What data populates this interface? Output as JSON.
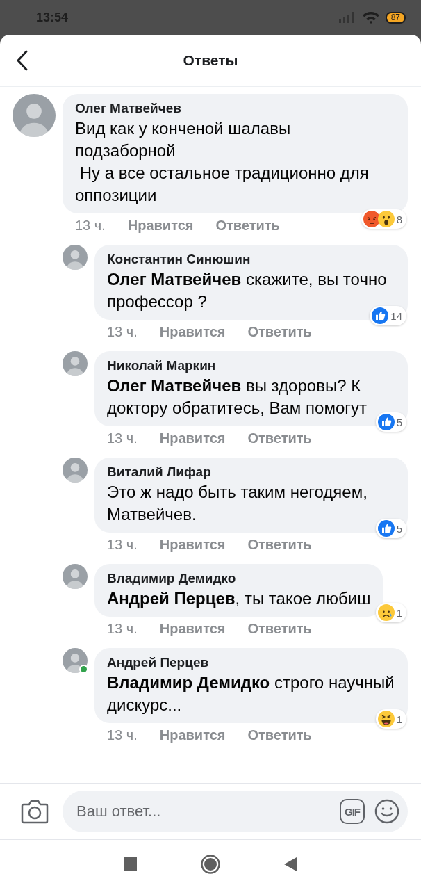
{
  "status_bar": {
    "time": "13:54",
    "battery": "87"
  },
  "header": {
    "title": "Ответы"
  },
  "comments": [
    {
      "author": "Олег Матвейчев",
      "text": "Вид как у конченой шалавы подзаборной\n Ну а все остальное традиционно для оппозиции",
      "reply": false,
      "online": false,
      "time": "13 ч.",
      "like": "Нравится",
      "answer": "Ответить",
      "reactions": [
        {
          "kind": "angry"
        },
        {
          "kind": "wow"
        }
      ],
      "reaction_count": "8"
    },
    {
      "author": "Константин Синюшин",
      "text": "**Олег Матвейчев** скажите, вы точно профессор ?",
      "reply": true,
      "online": false,
      "time": "13 ч.",
      "like": "Нравится",
      "answer": "Ответить",
      "reactions": [
        {
          "kind": "like"
        }
      ],
      "reaction_count": "14"
    },
    {
      "author": "Николай Маркин",
      "text": "**Олег Матвейчев** вы здоровы? К доктору обратитесь, Вам помогут",
      "reply": true,
      "online": false,
      "time": "13 ч.",
      "like": "Нравится",
      "answer": "Ответить",
      "reactions": [
        {
          "kind": "like"
        }
      ],
      "reaction_count": "5"
    },
    {
      "author": "Виталий Лифар",
      "text": "Это ж надо быть таким негодяем, Матвейчев.",
      "reply": true,
      "online": false,
      "time": "13 ч.",
      "like": "Нравится",
      "answer": "Ответить",
      "reactions": [
        {
          "kind": "like"
        }
      ],
      "reaction_count": "5"
    },
    {
      "author": "Владимир Демидко",
      "text": "**Андрей Перцев**, ты такое любиш",
      "reply": true,
      "online": false,
      "time": "13 ч.",
      "like": "Нравится",
      "answer": "Ответить",
      "reactions": [
        {
          "kind": "sad"
        }
      ],
      "reaction_count": "1"
    },
    {
      "author": "Андрей Перцев",
      "text": "**Владимир Демидко** строго научный дискурс...",
      "reply": true,
      "online": true,
      "time": "13 ч.",
      "like": "Нравится",
      "answer": "Ответить",
      "reactions": [
        {
          "kind": "haha"
        }
      ],
      "reaction_count": "1"
    }
  ],
  "composer": {
    "placeholder": "Ваш ответ...",
    "gif": "GIF"
  }
}
